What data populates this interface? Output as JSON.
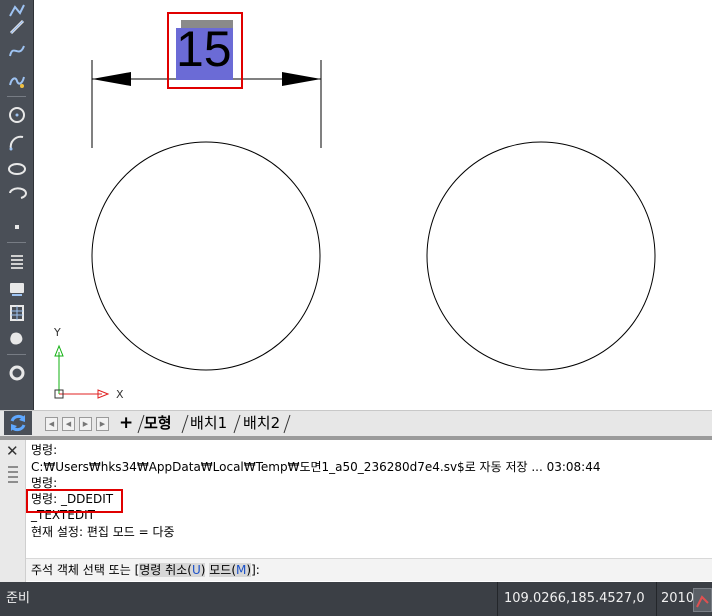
{
  "canvas": {
    "dimension_text": "15",
    "ucs": {
      "x_label": "X",
      "y_label": "Y"
    }
  },
  "tabs": {
    "add_symbol": "+",
    "items": [
      {
        "label": "모형"
      },
      {
        "label": "배치1"
      },
      {
        "label": "배치2"
      }
    ]
  },
  "command_window": {
    "close_symbol": "✕",
    "history": [
      "명령:",
      "C:₩Users₩hks34₩AppData₩Local₩Temp₩도면1_a50_236280d7e4.sv$로 자동 저장 ... 03:08:44",
      "명령:",
      "명령: _DDEDIT",
      "_TEXTEDIT",
      "현재 설정: 편집 모드 = 다중"
    ],
    "prompt": {
      "prefix": "주석 객체 선택 또는 [",
      "option1_text": "명령 취소(",
      "option1_key": "U",
      "option1_close": ")",
      "space": " ",
      "option2_text": "모드(",
      "option2_key": "M",
      "option2_close": ")",
      "suffix": "]:"
    }
  },
  "status_bar": {
    "ready": "준비",
    "coordinates": "109.0266,185.4527,0",
    "version": "2010"
  },
  "colors": {
    "toolbar_bg": "#4a4f57",
    "highlight": "#6b6bd6",
    "annotation_red": "#e00000",
    "ucs_x": "#e02020",
    "ucs_y": "#10b010"
  }
}
